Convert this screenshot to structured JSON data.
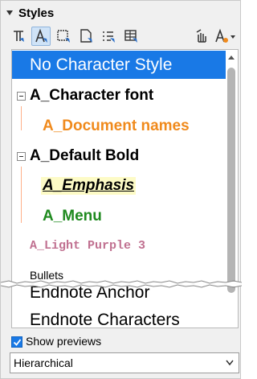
{
  "panel": {
    "title": "Styles"
  },
  "toolbar": {
    "icons": [
      "paragraph-styles-icon",
      "character-styles-icon",
      "frame-styles-icon",
      "page-styles-icon",
      "list-styles-icon",
      "table-styles-icon",
      "fill-format-mode-icon",
      "style-actions-icon"
    ]
  },
  "styles": [
    {
      "label": "No Character Style",
      "selected": true
    },
    {
      "label": "A_Character font",
      "expanded": true
    },
    {
      "label": "A_Document names"
    },
    {
      "label": "A_Default Bold",
      "expanded": true
    },
    {
      "label": "A_Emphasis"
    },
    {
      "label": "A_Menu"
    },
    {
      "label": "A_Light Purple 3"
    },
    {
      "label": "Bullets"
    },
    {
      "label": "Endnote Anchor"
    },
    {
      "label": "Endnote Characters"
    }
  ],
  "footer": {
    "show_previews_label": "Show previews",
    "show_previews_checked": true,
    "filter_value": "Hierarchical"
  },
  "colors": {
    "selection": "#1979e6",
    "document_names": "#f08a1c",
    "menu": "#1f8a1f",
    "emphasis_highlight": "#fdfbc6",
    "light_purple": "#c07090"
  }
}
